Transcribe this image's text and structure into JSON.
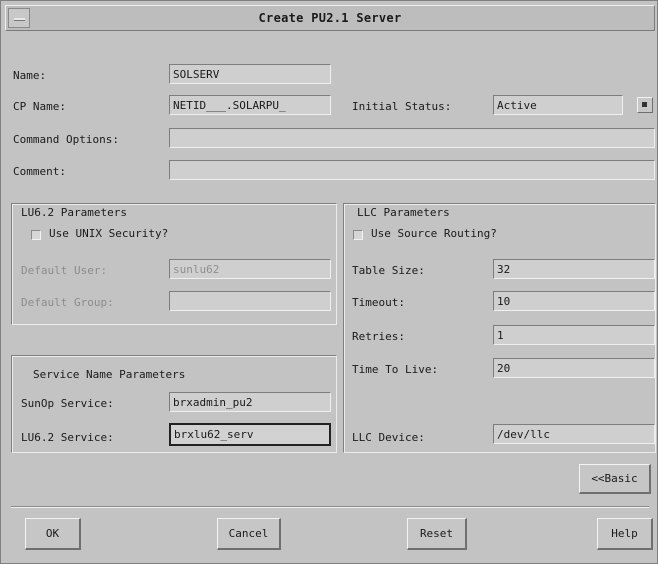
{
  "window": {
    "title": "Create PU2.1 Server"
  },
  "form": {
    "name": {
      "label": "Name:",
      "value": "SOLSERV"
    },
    "cp_name": {
      "label": "CP Name:",
      "value": "NETID___.SOLARPU_"
    },
    "initial_status": {
      "label": "Initial Status:",
      "value": "Active"
    },
    "command_options": {
      "label": "Command Options:",
      "value": ""
    },
    "comment": {
      "label": "Comment:",
      "value": ""
    }
  },
  "lu62": {
    "title": "LU6.2 Parameters",
    "use_unix_security": {
      "label": "Use UNIX Security?",
      "checked": false
    },
    "default_user": {
      "label": "Default User:",
      "value": "sunlu62"
    },
    "default_group": {
      "label": "Default Group:",
      "value": ""
    }
  },
  "service": {
    "title": "Service Name Parameters",
    "sunop_service": {
      "label": "SunOp Service:",
      "value": "brxadmin_pu2"
    },
    "lu62_service": {
      "label": "LU6.2 Service:",
      "value": "brxlu62_serv"
    }
  },
  "llc": {
    "title": "LLC Parameters",
    "use_source_routing": {
      "label": "Use Source Routing?",
      "checked": false
    },
    "table_size": {
      "label": "Table Size:",
      "value": "32"
    },
    "timeout": {
      "label": "Timeout:",
      "value": "10"
    },
    "retries": {
      "label": "Retries:",
      "value": "1"
    },
    "time_to_live": {
      "label": "Time To Live:",
      "value": "20"
    },
    "llc_device": {
      "label": "LLC Device:",
      "value": "/dev/llc"
    }
  },
  "buttons": {
    "basic": "<<Basic",
    "ok": "OK",
    "cancel": "Cancel",
    "reset": "Reset",
    "help": "Help"
  },
  "colors": {
    "window_bg": "#c3c3c3",
    "field_bg": "#cfcfcf",
    "disabled_text": "#8c8c8c"
  },
  "icons": {
    "system_menu": "window-menu-icon",
    "dropdown": "dropdown-arrow-icon",
    "checkbox": "checkbox-icon"
  }
}
